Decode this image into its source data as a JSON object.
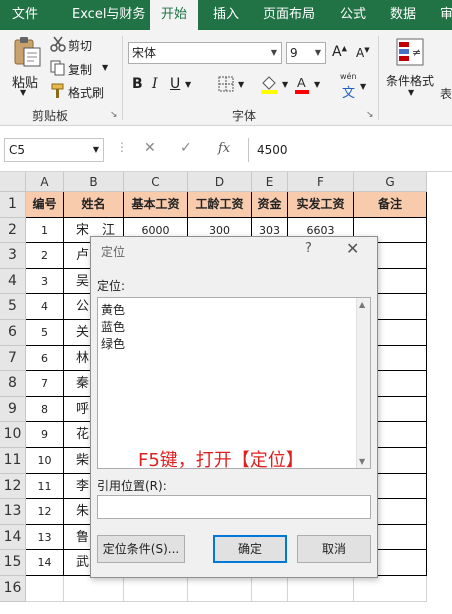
{
  "ribbon": {
    "tabs": [
      {
        "label": "文件",
        "active": false
      },
      {
        "label": "Excel与财务",
        "active": false
      },
      {
        "label": "开始",
        "active": true
      },
      {
        "label": "插入",
        "active": false
      },
      {
        "label": "页面布局",
        "active": false
      },
      {
        "label": "公式",
        "active": false
      },
      {
        "label": "数据",
        "active": false
      },
      {
        "label": "审",
        "active": false
      }
    ],
    "clipboard": {
      "paste": "粘贴",
      "cut": "剪切",
      "copy": "复制",
      "format_painter": "格式刷",
      "group_label": "剪贴板"
    },
    "font": {
      "name": "宋体",
      "size": "9",
      "wen": "wén",
      "wen_char": "文",
      "group_label": "字体"
    },
    "styles": {
      "conditional_format": "条件格式",
      "group_label": "表"
    }
  },
  "formula_bar": {
    "name_box": "C5",
    "fx": "fx",
    "value": "4500"
  },
  "sheet": {
    "columns": [
      "A",
      "B",
      "C",
      "D",
      "E",
      "F",
      "G"
    ],
    "rows": [
      "1",
      "2",
      "3",
      "4",
      "5",
      "6",
      "7",
      "8",
      "9",
      "10",
      "11",
      "12",
      "13",
      "14",
      "15",
      "16"
    ],
    "header_row": [
      "编号",
      "姓名",
      "基本工资",
      "工龄工资",
      "资金",
      "实发工资",
      "备注"
    ],
    "data_rows": [
      [
        "1",
        "宋　江",
        "6000",
        "300",
        "303",
        "6603",
        ""
      ],
      [
        "2",
        "卢",
        "",
        "",
        "",
        "",
        ""
      ],
      [
        "3",
        "吴",
        "",
        "",
        "",
        "",
        ""
      ],
      [
        "4",
        "公",
        "",
        "",
        "",
        "",
        ""
      ],
      [
        "5",
        "关",
        "",
        "",
        "",
        "",
        ""
      ],
      [
        "6",
        "林",
        "",
        "",
        "",
        "",
        ""
      ],
      [
        "7",
        "秦",
        "",
        "",
        "",
        "",
        ""
      ],
      [
        "8",
        "呼",
        "",
        "",
        "",
        "",
        ""
      ],
      [
        "9",
        "花",
        "",
        "",
        "",
        "",
        ""
      ],
      [
        "10",
        "柴",
        "",
        "",
        "",
        "",
        ""
      ],
      [
        "11",
        "李",
        "",
        "",
        "",
        "",
        ""
      ],
      [
        "12",
        "朱",
        "",
        "",
        "",
        "",
        ""
      ],
      [
        "13",
        "鲁",
        "",
        "",
        "",
        "",
        ""
      ],
      [
        "14",
        "武",
        "",
        "",
        "",
        "",
        ""
      ]
    ]
  },
  "dialog": {
    "title": "定位",
    "help": "?",
    "close": "✕",
    "goto_label": "定位:",
    "list_items": [
      "黄色",
      "蓝色",
      "绿色"
    ],
    "annotation": "F5键，打开【定位】",
    "reference_label": "引用位置(R):",
    "reference_value": "",
    "special_button": "定位条件(S)...",
    "ok_button": "确定",
    "cancel_button": "取消"
  },
  "colors": {
    "ribbon_green": "#217346",
    "header_fill": "#f8cbad",
    "annotation_red": "#e02020",
    "default_button_border": "#0078d7"
  }
}
